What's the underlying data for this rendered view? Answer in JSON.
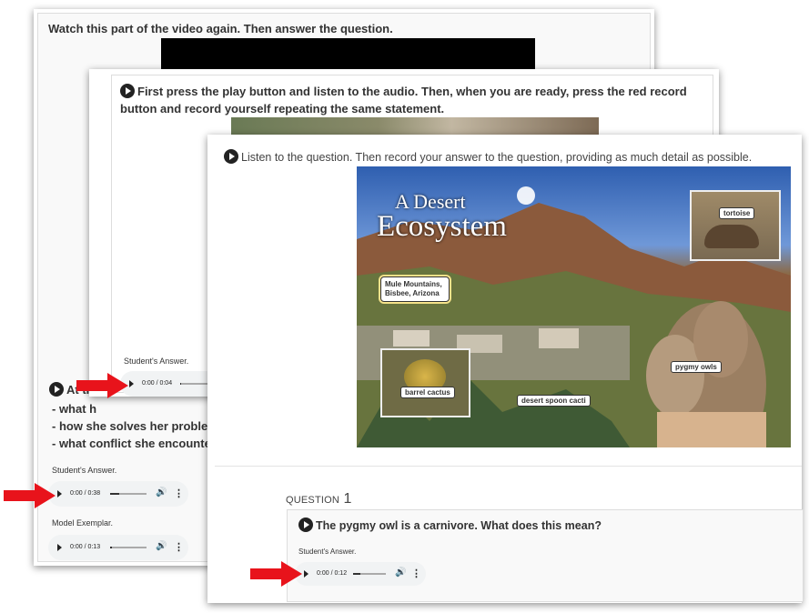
{
  "card1": {
    "instruction": "Watch this part of the video again. Then answer the question.",
    "partial_lead": "At th",
    "bullets": [
      "- what h",
      "- how she solves her problem",
      "- what conflict she encounte"
    ],
    "student_answer_label": "Student's Answer.",
    "student_audio_time": "0:00 / 0:38",
    "model_label": "Model Exemplar.",
    "model_audio_time": "0:00 / 0:13"
  },
  "card2": {
    "instruction": "First press the play button and listen to the audio. Then, when you are ready, press the red record button and record yourself repeating the same statement.",
    "student_answer_label": "Student's Answer.",
    "audio_time": "0:00 / 0:04"
  },
  "card3": {
    "instruction": "Listen to the question. Then record your answer to the question, providing as much detail as possible.",
    "image": {
      "title_line1": "A Desert",
      "title_line2": "Ecosystem",
      "labels": {
        "tortoise": "tortoise",
        "mountains": "Mule Mountains, Bisbee, Arizona",
        "pygmy_owls": "pygmy owls",
        "barrel_cactus": "barrel cactus",
        "spoon_cacti": "desert spoon cacti"
      }
    },
    "question_word": "QUESTION",
    "question_number": "1",
    "question_text": "The pygmy owl is a carnivore. What does this mean?",
    "student_answer_label": "Student's Answer.",
    "audio_time": "0:00 / 0:12"
  },
  "colors": {
    "arrow": "#e8131b",
    "audio_bg": "#f1f3f4",
    "sky": "#3f6fc0"
  }
}
